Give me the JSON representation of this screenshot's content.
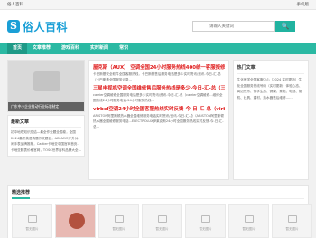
{
  "topbar": {
    "left": "俗人百科",
    "right": "手机版"
  },
  "logo": {
    "badge": "S",
    "text": "俗人百科"
  },
  "search": {
    "placeholder": "请输入关键词",
    "button": "🔍"
  },
  "nav": [
    {
      "label": "首页"
    },
    {
      "label": "文章推荐"
    },
    {
      "label": "游戏百科"
    },
    {
      "label": "实时新闻"
    },
    {
      "label": "常识"
    }
  ],
  "banner": {
    "caption": "广东中小企业推动行业标准制定"
  },
  "left_panel": {
    "title": "最新文章",
    "text": "初中地理知识总结—最全作业题全国卷，全国2024高考英语真题作文题目，ADMAYE户外休闲手表品牌推荐，Cartier卡地亚中国官网首页-卡地亚腕表价格官网，TOSC世界百科品牌大全..."
  },
  "articles": [
    {
      "title": "屋克斯（AUX）  空调全国24小时服务热线400统一客服报修热线...",
      "color": "#e02020",
      "body": "卡巴斯基安全软件全国客服热线，卡巴斯基售后服务电话是多少实时资讯/资讯-今日-汇-总（卡巴斯基全国服务记录..."
    },
    {
      "title": "三星电视机空调全国维修售后服务热线是多少-今日-汇-总（三星电视机空调...",
      "color": "#e02020",
      "body": "carrier空调维修全国服务电话是多少实时资讯/资讯-今日-汇-总（carrier空调维修...维修全国热线24小时服务电话-24小时服务热线..."
    },
    {
      "title": "virbel空调24小时全国客服热线实时反馈-今-日-汇-总（virbel空...",
      "color": "#e02020",
      "body": "ARISTON阿里斯顿热水器全国维修服务电话实时资讯/资讯-今日-汇-总（ARISTON阿里斯顿热水器全国维修服务电话...ELECTROLUX伊莱克斯24小时全国服务热线实时反馈-今-日-汇-总..."
    }
  ],
  "right_panel": {
    "title": "热门文章",
    "text": "生化医学全国客服中心（2024 实时更新）生化全国服务热线号码（实时更新）体验心态、周边长乐、化学生态、健康、家电、电视、烟机、灶具、建材、热水器售后维修……"
  },
  "bottom": {
    "title": "精选推荐",
    "thumbs": [
      {
        "label": "暂无图片",
        "caption": "暂无图片"
      },
      {
        "label": "",
        "caption": ""
      },
      {
        "label": "暂无图片",
        "caption": "暂无图片"
      },
      {
        "label": "暂无图片",
        "caption": "暂无图片"
      },
      {
        "label": "暂无图片",
        "caption": "暂无图片"
      },
      {
        "label": "暂无图片",
        "caption": "暂无图片"
      },
      {
        "label": "暂无图片",
        "caption": "暂无图片"
      }
    ]
  },
  "colors": {
    "accent": "#2bb9a3",
    "brand": "#1a9fd6",
    "headline": "#e02020"
  }
}
